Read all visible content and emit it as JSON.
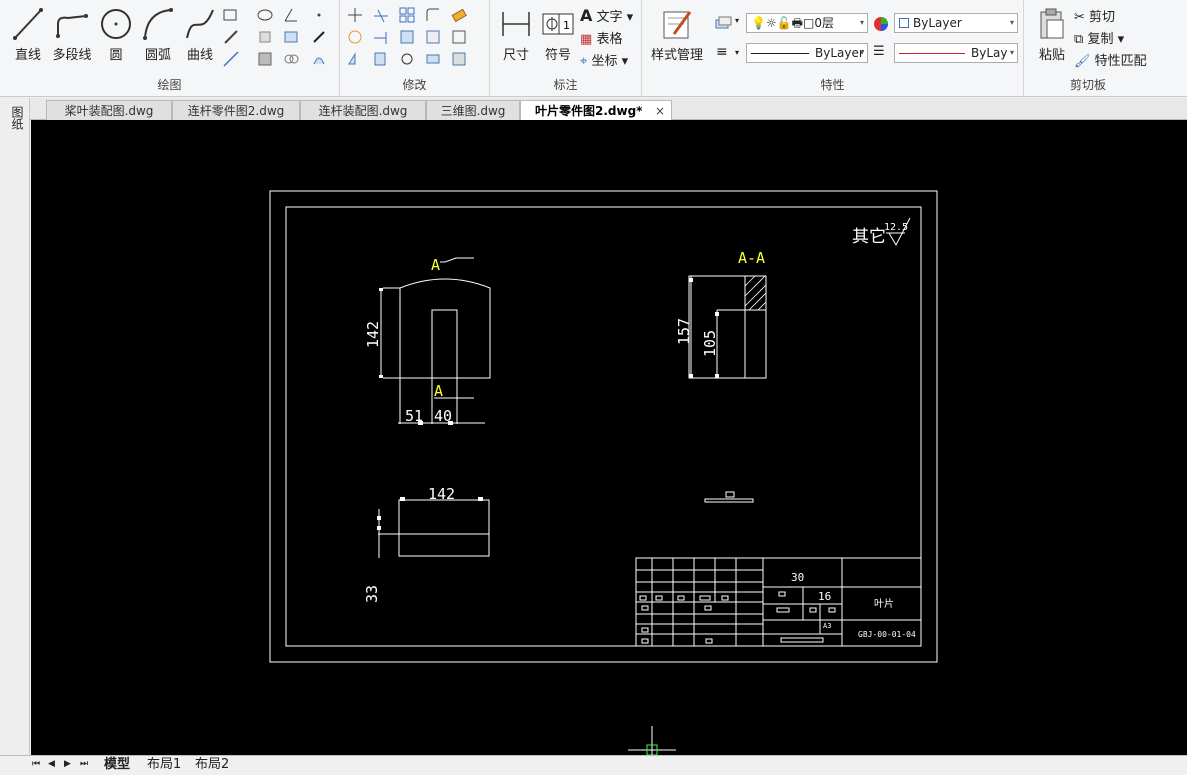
{
  "ribbon": {
    "draw": {
      "label": "绘图",
      "line": "直线",
      "polyline": "多段线",
      "circle": "圆",
      "arc": "圆弧",
      "spline": "曲线"
    },
    "modify": {
      "label": "修改"
    },
    "annotate": {
      "label": "标注",
      "dimension": "尺寸",
      "symbol": "符号",
      "text": "文字",
      "table": "表格",
      "coordinate": "坐标"
    },
    "properties": {
      "label": "特性",
      "style_manager": "样式管理",
      "layer": "0层",
      "color": "ByLayer",
      "linetype": "ByLayer",
      "lineweight": "ByLay"
    },
    "clipboard": {
      "label": "剪切板",
      "paste": "粘贴",
      "cut": "剪切",
      "copy": "复制",
      "match": "特性匹配"
    }
  },
  "doc_tabs": [
    {
      "label": "桨叶装配图.dwg"
    },
    {
      "label": "连杆零件图2.dwg"
    },
    {
      "label": "连杆装配图.dwg"
    },
    {
      "label": "三维图.dwg"
    },
    {
      "label": "叶片零件图2.dwg*"
    }
  ],
  "active_tab_close": "×",
  "left_strip_label": "图纸",
  "drawing": {
    "roughness_label": "其它",
    "roughness_value": "12.5",
    "section_marker_top": "A",
    "section_marker_bottom": "A",
    "section_title": "A-A",
    "dim_height_front": "142",
    "dim_width_51": "51",
    "dim_width_40": "40",
    "dim_height_section": "157",
    "dim_height_section_inner": "105",
    "dim_width_top": "142",
    "dim_thickness": "33",
    "tb_scale": "30",
    "tb_count": "16",
    "tb_name": "叶片",
    "tb_code": "GBJ-00-01-04",
    "tb_small": "A3"
  },
  "layout_tabs": [
    {
      "label": "模型"
    },
    {
      "label": "布局1"
    },
    {
      "label": "布局2"
    }
  ],
  "nav_buttons": [
    "⏮",
    "◀",
    "▶",
    "⏭"
  ]
}
